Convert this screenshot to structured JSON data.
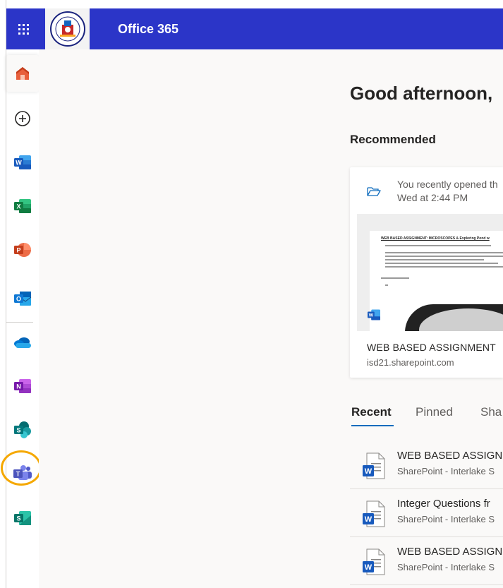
{
  "header": {
    "app_title": "Office 365"
  },
  "rail": {
    "items": [
      {
        "name": "home",
        "icon": "home-icon"
      },
      {
        "name": "create",
        "icon": "plus-circle-icon"
      },
      {
        "name": "word",
        "icon": "word-icon",
        "letter": "W",
        "color": "#2b579a"
      },
      {
        "name": "excel",
        "icon": "excel-icon",
        "letter": "X",
        "color": "#217346"
      },
      {
        "name": "powerpoint",
        "icon": "powerpoint-icon",
        "letter": "P",
        "color": "#d24726"
      },
      {
        "name": "outlook",
        "icon": "outlook-icon",
        "letter": "O",
        "color": "#0078d4"
      },
      {
        "name": "onedrive",
        "icon": "onedrive-icon",
        "color": "#0364b8"
      },
      {
        "name": "onenote",
        "icon": "onenote-icon",
        "letter": "N",
        "color": "#7719aa"
      },
      {
        "name": "sharepoint",
        "icon": "sharepoint-icon",
        "letter": "S",
        "color": "#038387"
      },
      {
        "name": "teams",
        "icon": "teams-icon",
        "letter": "T",
        "color": "#4b53bc"
      },
      {
        "name": "sway",
        "icon": "sway-icon",
        "letter": "S",
        "color": "#008272"
      }
    ],
    "accent": "#d83b01",
    "highlight_color": "#f5a800"
  },
  "main": {
    "greeting": "Good afternoon,",
    "recommended_heading": "Recommended",
    "card": {
      "activity": "You recently opened th",
      "time": "Wed at 2:44 PM",
      "preview_title": "WEB BASED ASSIGNMENT: MICROSCOPES & Exploring Pond w",
      "name": "WEB BASED ASSIGNMENT",
      "site": "isd21.sharepoint.com"
    },
    "tabs": [
      {
        "label": "Recent",
        "selected": true
      },
      {
        "label": "Pinned",
        "selected": false
      },
      {
        "label": "Sha",
        "selected": false
      }
    ],
    "files": [
      {
        "name": "WEB BASED ASSIGN",
        "location": "SharePoint - Interlake S"
      },
      {
        "name": "Integer Questions fr",
        "location": "SharePoint - Interlake S"
      },
      {
        "name": "WEB BASED ASSIGN",
        "location": "SharePoint - Interlake S"
      }
    ]
  }
}
